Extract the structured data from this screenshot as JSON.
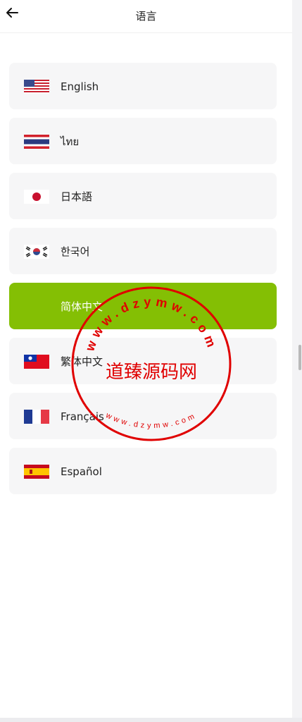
{
  "header": {
    "title": "语言"
  },
  "languages": [
    {
      "label": "English",
      "flag": "us-flag-icon"
    },
    {
      "label": "ไทย",
      "flag": "thailand-flag-icon"
    },
    {
      "label": "日本語",
      "flag": "japan-flag-icon"
    },
    {
      "label": "한국어",
      "flag": "korea-flag-icon"
    },
    {
      "label": "简体中文",
      "flag": "china-flag-icon",
      "selected": true
    },
    {
      "label": "繁体中文",
      "flag": "taiwan-flag-icon"
    },
    {
      "label": "Français",
      "flag": "france-flag-icon"
    },
    {
      "label": "Español",
      "flag": "spain-flag-icon"
    }
  ],
  "watermark": {
    "main_text": "道臻源码网",
    "ring_text": "www.dzymw.com"
  },
  "colors": {
    "accent": "#84bf04",
    "card": "#f6f6f7",
    "watermark": "#e00000"
  }
}
